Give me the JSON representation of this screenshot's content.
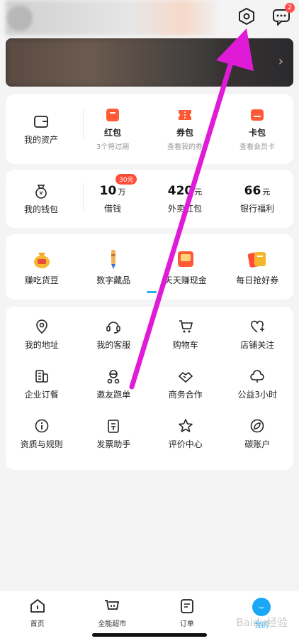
{
  "header": {
    "settings_icon": "hexagon-settings-icon",
    "message_icon": "chat-icon",
    "message_badge": "2"
  },
  "assets_card": {
    "left": {
      "label": "我的资产",
      "icon": "wallet-icon"
    },
    "items": [
      {
        "title": "红包",
        "sub": "3个将过期",
        "icon": "red-packet-icon"
      },
      {
        "title": "券包",
        "sub": "查看我的券",
        "icon": "coupon-icon"
      },
      {
        "title": "卡包",
        "sub": "查看会员卡",
        "icon": "card-icon"
      }
    ]
  },
  "wallet_card": {
    "left": {
      "label": "我的钱包",
      "icon": "money-bag-icon"
    },
    "pill": "30元",
    "items": [
      {
        "value": "10",
        "unit": "万",
        "label": "借钱"
      },
      {
        "value": "420",
        "unit": "元",
        "label": "外卖红包"
      },
      {
        "value": "66",
        "unit": "元",
        "label": "银行福利"
      }
    ]
  },
  "promo_card": {
    "items": [
      {
        "label": "赚吃货豆",
        "icon": "coin-bag-icon"
      },
      {
        "label": "数字藏品",
        "icon": "pen-collectible-icon"
      },
      {
        "label": "天天赚现金",
        "icon": "cash-envelope-icon"
      },
      {
        "label": "每日抢好券",
        "icon": "coupon-stack-icon"
      }
    ]
  },
  "services": [
    {
      "label": "我的地址",
      "icon": "location-icon"
    },
    {
      "label": "我的客服",
      "icon": "headset-icon"
    },
    {
      "label": "购物车",
      "icon": "cart-icon"
    },
    {
      "label": "店铺关注",
      "icon": "heart-plus-icon"
    },
    {
      "label": "企业订餐",
      "icon": "building-icon"
    },
    {
      "label": "邀友跑单",
      "icon": "rider-icon"
    },
    {
      "label": "商务合作",
      "icon": "handshake-icon"
    },
    {
      "label": "公益3小时",
      "icon": "charity-icon"
    },
    {
      "label": "资质与规则",
      "icon": "info-icon"
    },
    {
      "label": "发票助手",
      "icon": "invoice-icon"
    },
    {
      "label": "评价中心",
      "icon": "star-icon"
    },
    {
      "label": "碳账户",
      "icon": "leaf-icon"
    }
  ],
  "tabbar": {
    "tabs": [
      {
        "label": "首页",
        "icon": "home-icon"
      },
      {
        "label": "全能超市",
        "icon": "basket-icon"
      },
      {
        "label": "订单",
        "icon": "order-icon"
      },
      {
        "label": "我的",
        "icon": "profile-icon"
      }
    ]
  },
  "watermark": "Baidu经验",
  "colors": {
    "accent": "#1aa7f5",
    "red": "#ff4d3a",
    "arrow": "#e01bd8"
  }
}
